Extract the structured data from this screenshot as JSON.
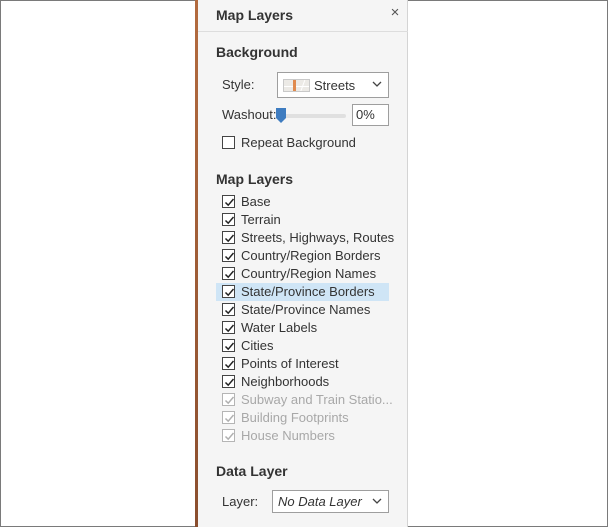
{
  "panel": {
    "title": "Map Layers",
    "close_glyph": "×"
  },
  "background": {
    "heading": "Background",
    "style_label": "Style:",
    "style_value": "Streets",
    "style_icon": "streets-map-thumbnail",
    "washout_label": "Washout:",
    "washout_value": "0%",
    "washout_level": 0,
    "repeat_label": "Repeat Background",
    "repeat_checked": false
  },
  "map_layers": {
    "heading": "Map Layers",
    "items": [
      {
        "label": "Base",
        "checked": true,
        "enabled": true
      },
      {
        "label": "Terrain",
        "checked": true,
        "enabled": true
      },
      {
        "label": "Streets, Highways, Routes",
        "checked": true,
        "enabled": true
      },
      {
        "label": "Country/Region Borders",
        "checked": true,
        "enabled": true
      },
      {
        "label": "Country/Region Names",
        "checked": true,
        "enabled": true
      },
      {
        "label": "State/Province Borders",
        "checked": true,
        "enabled": true,
        "selected": true
      },
      {
        "label": "State/Province Names",
        "checked": true,
        "enabled": true
      },
      {
        "label": "Water Labels",
        "checked": true,
        "enabled": true
      },
      {
        "label": "Cities",
        "checked": true,
        "enabled": true
      },
      {
        "label": "Points of Interest",
        "checked": true,
        "enabled": true
      },
      {
        "label": "Neighborhoods",
        "checked": true,
        "enabled": true
      },
      {
        "label": "Subway and Train Statio...",
        "checked": true,
        "enabled": false
      },
      {
        "label": "Building Footprints",
        "checked": true,
        "enabled": false
      },
      {
        "label": "House Numbers",
        "checked": true,
        "enabled": false
      }
    ]
  },
  "data_layer": {
    "heading": "Data Layer",
    "layer_label": "Layer:",
    "layer_value": "No Data Layer"
  },
  "colors": {
    "accent_bar": "#9c5a35",
    "selection": "#cfe5f6",
    "slider_thumb": "#3e7cc0"
  }
}
